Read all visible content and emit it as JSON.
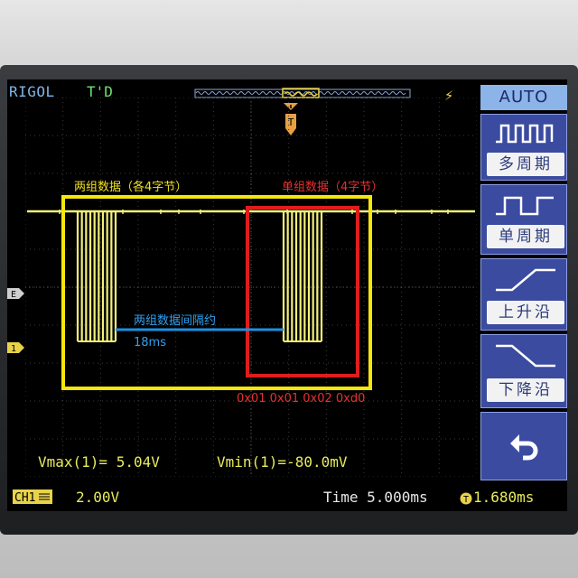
{
  "scope": {
    "brand": "RIGOL",
    "trigger_state": "T'D",
    "trigger_edge_icon": "rising-edge-trigger-icon",
    "channel_label": "CH1",
    "volts_per_div": "2.00V",
    "timebase": "Time 5.000ms",
    "trigger_offset": "1.680ms",
    "trigger_position_icon": "trigger-position-icon"
  },
  "measurements": {
    "vmax": "Vmax(1)= 5.04V",
    "vmin": "Vmin(1)=-80.0mV"
  },
  "menu": {
    "auto_label": "AUTO",
    "items": [
      {
        "label": "多周期",
        "icon": "multi-period-pulse-icon"
      },
      {
        "label": "单周期",
        "icon": "single-period-pulse-icon"
      },
      {
        "label": "上升沿",
        "icon": "rising-edge-icon"
      },
      {
        "label": "下降沿",
        "icon": "falling-edge-icon"
      }
    ],
    "undo_icon": "undo-arrow-icon"
  },
  "annotations": {
    "yellow_box_label": "两组数据（各4字节）",
    "red_box_label": "单组数据（4字节）",
    "interval_label": "两组数据间隔约",
    "interval_value": "18ms",
    "bytes_label": "0x01 0x01 0x02 0xd0"
  },
  "markers": {
    "trigger_level": "E",
    "channel1": "1"
  },
  "colors": {
    "trace": "#f2f07a",
    "yellow_box": "#f5e60c",
    "red_box": "#e01c1c",
    "blue_line": "#1e90e0",
    "red_text": "#e83030",
    "yellow_text": "#f0e020",
    "blue_text": "#2fa0f0",
    "brand": "#7fb6e8",
    "trigger_state": "#6ee06e",
    "menu_active": "#8db4e8"
  }
}
